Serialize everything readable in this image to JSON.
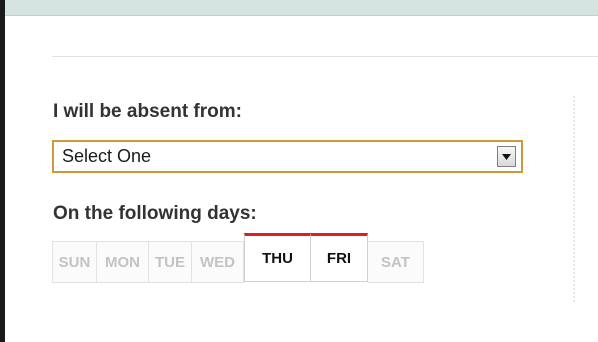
{
  "form": {
    "absent_label": "I will be absent from:",
    "select_value": "Select One",
    "days_label": "On the following days:"
  },
  "days": [
    {
      "label": "SUN",
      "selected": false
    },
    {
      "label": "MON",
      "selected": false
    },
    {
      "label": "TUE",
      "selected": false
    },
    {
      "label": "WED",
      "selected": false
    },
    {
      "label": "THU",
      "selected": true
    },
    {
      "label": "FRI",
      "selected": true
    },
    {
      "label": "SAT",
      "selected": false
    }
  ],
  "colors": {
    "accent_selected": "#e02020",
    "select_border": "#cc9a3a",
    "top_band": "#d6e4e1"
  },
  "icons": {
    "select_arrow": "chevron-down-icon"
  }
}
